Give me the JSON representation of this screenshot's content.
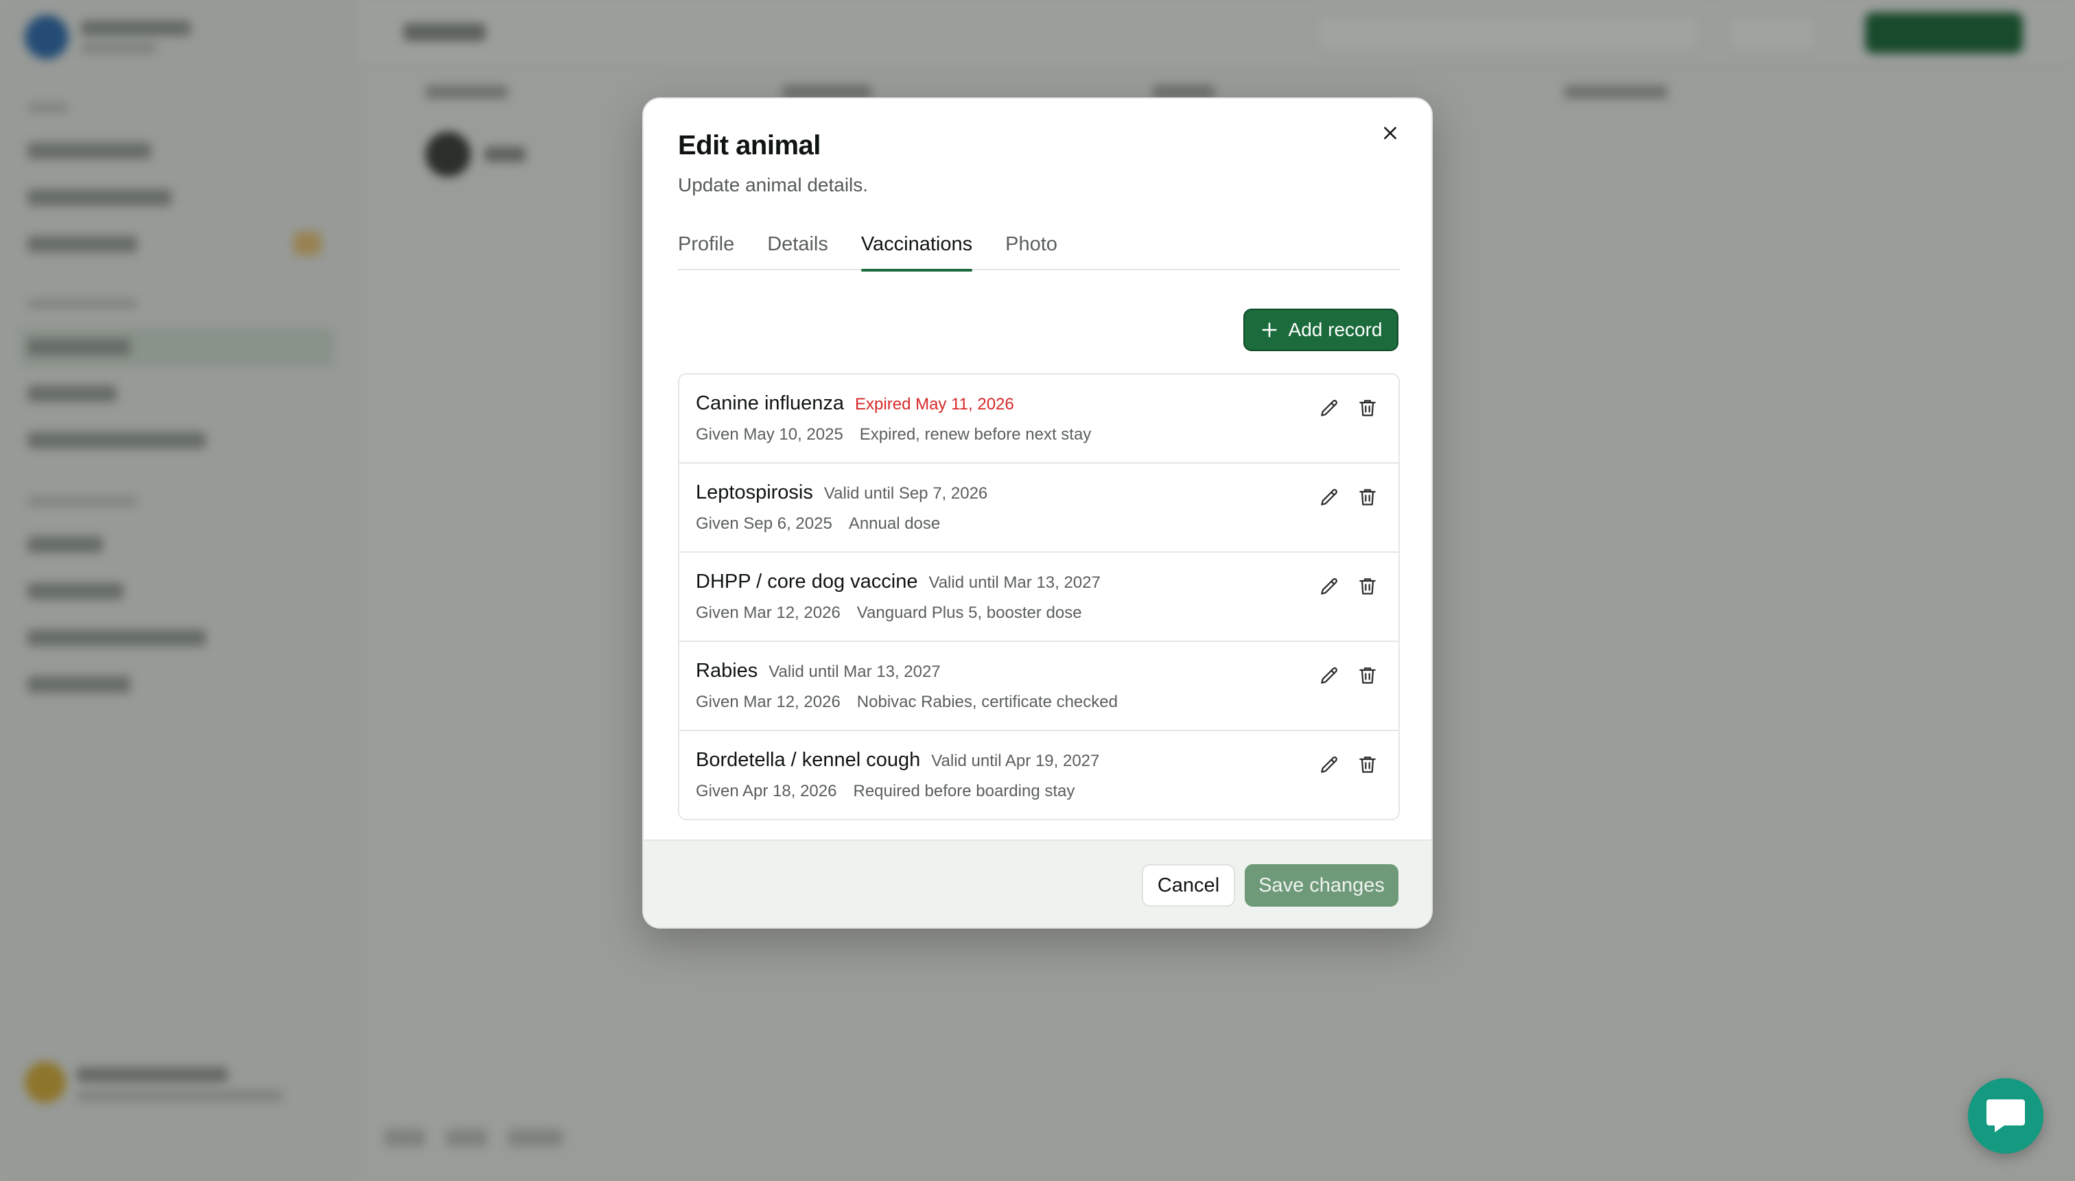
{
  "modal": {
    "title": "Edit animal",
    "subtitle": "Update animal details.",
    "close_icon": "close-icon",
    "tabs": [
      {
        "label": "Profile",
        "active": false
      },
      {
        "label": "Details",
        "active": false
      },
      {
        "label": "Vaccinations",
        "active": true
      },
      {
        "label": "Photo",
        "active": false
      }
    ],
    "add_record_label": "Add record",
    "records": [
      {
        "name": "Canine influenza",
        "status": "Expired May 11, 2026",
        "expired": true,
        "given": "Given May 10, 2025",
        "note": "Expired, renew before next stay"
      },
      {
        "name": "Leptospirosis",
        "status": "Valid until Sep 7, 2026",
        "expired": false,
        "given": "Given Sep 6, 2025",
        "note": "Annual dose"
      },
      {
        "name": "DHPP / core dog vaccine",
        "status": "Valid until Mar 13, 2027",
        "expired": false,
        "given": "Given Mar 12, 2026",
        "note": "Vanguard Plus 5, booster dose"
      },
      {
        "name": "Rabies",
        "status": "Valid until Mar 13, 2027",
        "expired": false,
        "given": "Given Mar 12, 2026",
        "note": "Nobivac Rabies, certificate checked"
      },
      {
        "name": "Bordetella / kennel cough",
        "status": "Valid until Apr 19, 2027",
        "expired": false,
        "given": "Given Apr 18, 2026",
        "note": "Required before boarding stay"
      }
    ],
    "footer": {
      "cancel_label": "Cancel",
      "save_label": "Save changes"
    }
  },
  "colors": {
    "accent": "#1c6b3c",
    "expired": "#d62828",
    "chat": "#139a80"
  },
  "chat_widget": {
    "icon": "chat-bubble-icon"
  }
}
